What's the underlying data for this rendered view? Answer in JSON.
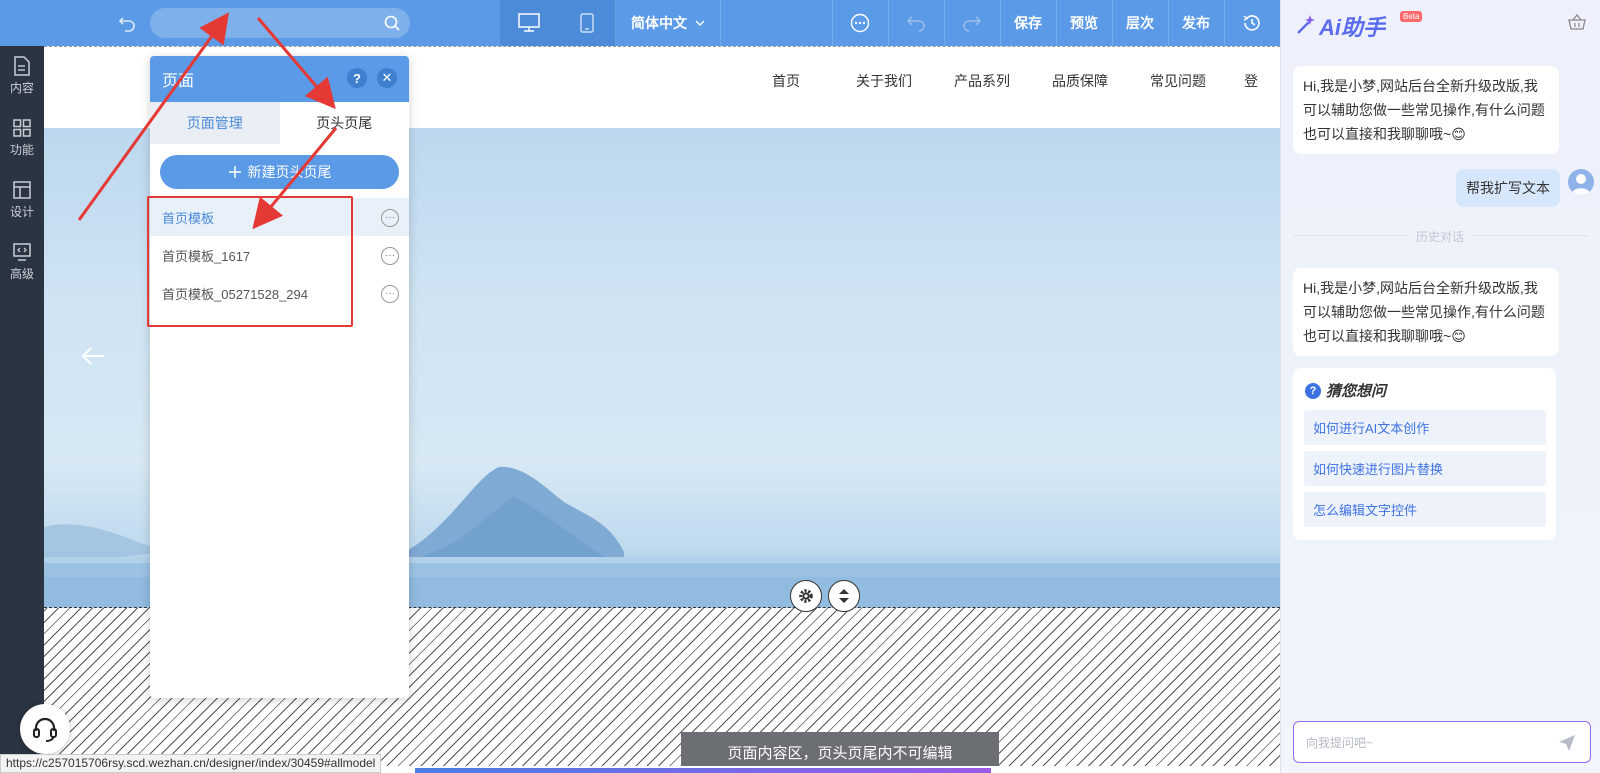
{
  "toolbar": {
    "language": "简体中文",
    "save": "保存",
    "preview": "预览",
    "layers": "层次",
    "publish": "发布"
  },
  "sidebar": {
    "items": [
      {
        "label": "内容",
        "icon": "file-icon"
      },
      {
        "label": "功能",
        "icon": "grid-icon"
      },
      {
        "label": "设计",
        "icon": "layout-icon"
      },
      {
        "label": "高级",
        "icon": "code-monitor-icon"
      }
    ]
  },
  "site": {
    "nav": [
      "首页",
      "关于我们",
      "产品系列",
      "品质保障",
      "常见问题",
      "登"
    ]
  },
  "canvas": {
    "content_note": "页面内容区，页头页尾内不可编辑"
  },
  "page_panel": {
    "title": "页面",
    "help": "?",
    "close": "✕",
    "tabs": [
      "页面管理",
      "页头页尾"
    ],
    "active_tab": "页头页尾",
    "new_button": "新建页头页尾",
    "templates": [
      "首页模板",
      "首页模板_1617",
      "首页模板_05271528_294"
    ],
    "more": "···"
  },
  "ai": {
    "title": "Ai助手",
    "beta": "Beta",
    "greeting": "Hi,我是小梦,网站后台全新升级改版,我可以辅助您做一些常见操作,有什么问题也可以直接和我聊聊哦~",
    "emoji": "😊",
    "user_message": "帮我扩写文本",
    "history_label": "历史对话",
    "greeting_2": "Hi,我是小梦,网站后台全新升级改版,我可以辅助您做一些常见操作,有什么问题也可以直接和我聊聊哦~",
    "guess_title": "猜您想问",
    "guess_items": [
      "如何进行AI文本创作",
      "如何快速进行图片替换",
      "怎么编辑文字控件"
    ],
    "input_placeholder": "向我提问吧~"
  },
  "status": {
    "url": "https://c257015706rsy.scd.wezhan.cn/designer/index/30459#allmodel"
  },
  "colors": {
    "toolbar": "#5a9ae6",
    "sidebar": "#2b3441",
    "accent_red": "#e53935",
    "ai_accent": "#5b6cf0"
  }
}
